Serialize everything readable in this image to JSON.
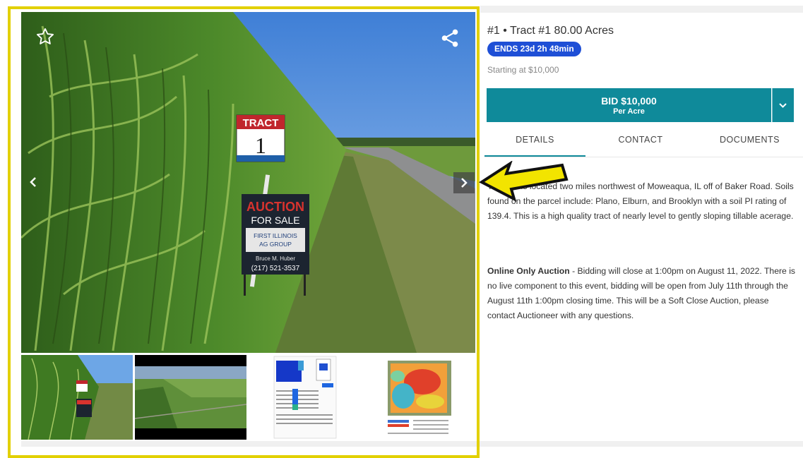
{
  "listing": {
    "title": "#1 • Tract #1 80.00 Acres",
    "ends_badge": "ENDS 23d 2h 48min",
    "starting": "Starting at $10,000"
  },
  "bid": {
    "label": "BID $10,000",
    "sublabel": "Per Acre"
  },
  "tabs": [
    "DETAILS",
    "CONTACT",
    "DOCUMENTS"
  ],
  "details": {
    "paragraph1": "Tract #1 is located two miles northwest of Moweaqua, IL off of Baker Road. Soils found on the parcel include: Plano, Elburn, and Brooklyn with a soil PI rating of 139.4. This is a high quality tract of nearly level to gently sloping tillable acerage.",
    "paragraph2_bold": "Online Only Auction",
    "paragraph2_rest": " - Bidding will close at 1:00pm on August 11, 2022. There is no live component to this event, bidding will be open from July 11th through the August 11th 1:00pm closing time.  This will be a Soft Close Auction, please contact Auctioneer with any questions."
  },
  "photo_signs": {
    "tract_word": "TRACT",
    "tract_number": "1",
    "tract_small": "First Illinois Ag Group",
    "auction_word": "AUCTION",
    "for_sale": "FOR SALE",
    "company_line1": "FIRST ILLINOIS",
    "company_line2": "AG GROUP",
    "agent": "Bruce M. Huber",
    "phone": "(217) 521-3537"
  },
  "icons": {
    "favorite": "star-outline-icon",
    "share": "share-icon",
    "prev": "chevron-left-icon",
    "next": "chevron-right-icon",
    "dropdown": "chevron-down-icon",
    "annotation": "arrow-left-annotation"
  },
  "colors": {
    "accent": "#0f8a9a",
    "badge": "#1e4fd6",
    "highlight_frame": "#e2d000",
    "annotation_arrow": "#f2e400"
  }
}
